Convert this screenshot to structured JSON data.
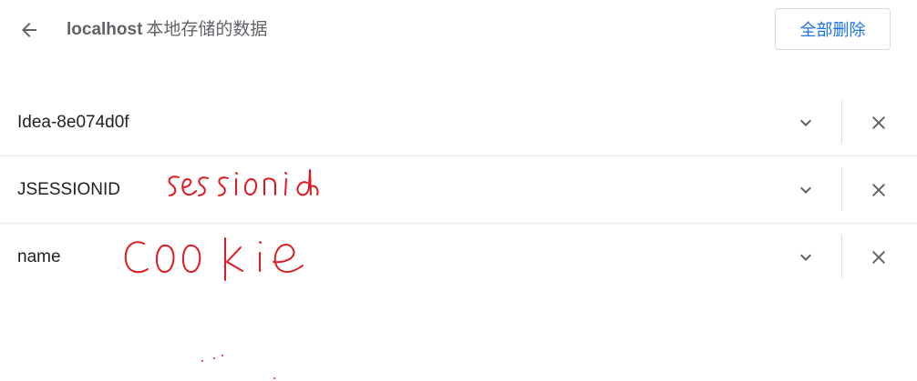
{
  "header": {
    "host": "localhost",
    "title_suffix": "本地存储的数据",
    "remove_all_label": "全部删除"
  },
  "cookies": [
    {
      "name": "Idea-8e074d0f"
    },
    {
      "name": "JSESSIONID"
    },
    {
      "name": "name"
    }
  ],
  "annotations": [
    "sessionid",
    "cookie"
  ],
  "colors": {
    "accent": "#1a73e8",
    "annotation": "#e0191f",
    "icon": "#5f6368"
  },
  "icons": [
    "arrow-back-icon",
    "chevron-down-icon",
    "close-icon"
  ]
}
